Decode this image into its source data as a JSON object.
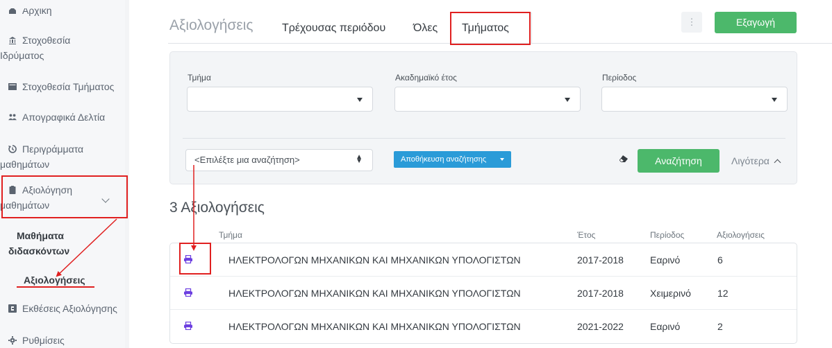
{
  "sidebar": {
    "items": [
      {
        "label": "Αρχική",
        "icon": "home-icon"
      },
      {
        "label": "Στοχοθεσία",
        "cont": "Ιδρύματος",
        "icon": "institution-icon"
      },
      {
        "label": "Στοχοθεσία Τμήματος",
        "icon": "department-icon"
      },
      {
        "label": "Απογραφικά Δελτία",
        "icon": "users-icon"
      },
      {
        "label": "Περιγράμματα",
        "cont": "μαθημάτων",
        "icon": "history-icon"
      },
      {
        "label": "Αξιολόγηση",
        "cont": "μαθημάτων",
        "icon": "clipboard-icon"
      },
      {
        "label": "Εκθέσεις Αξιολόγησης",
        "icon": "report-icon"
      },
      {
        "label": "Ρυθμίσεις",
        "icon": "gear-icon"
      }
    ],
    "sub_items": [
      {
        "label": "Μαθήματα",
        "cont": "διδασκόντων"
      },
      {
        "label": "Αξιολογήσεις"
      }
    ]
  },
  "header": {
    "title": "Αξιολογήσεις",
    "tabs": [
      "Τρέχουσας περιόδου",
      "Όλες",
      "Τμήματος"
    ],
    "active_tab": "Τμήματος",
    "more_label": "⋮",
    "export_label": "Εξαγωγή"
  },
  "filters": {
    "department_label": "Τμήμα",
    "year_label": "Ακαδημαϊκό έτος",
    "period_label": "Περίοδος",
    "search_select_value": "<Επιλέξτε μια αναζήτηση>",
    "save_search_label": "Αποθήκευση αναζήτησης",
    "search_label": "Αναζήτηση",
    "less_label": "Λιγότερα"
  },
  "results": {
    "title": "3 Αξιολογήσεις",
    "columns": [
      "Τμήμα",
      "Έτος",
      "Περίοδος",
      "Αξιολογήσεις"
    ],
    "rows": [
      {
        "department": "ΗΛΕΚΤΡΟΛΟΓΩΝ ΜΗΧΑΝΙΚΩΝ ΚΑΙ ΜΗΧΑΝΙΚΩΝ ΥΠΟΛΟΓΙΣΤΩΝ",
        "year": "2017-2018",
        "period": "Εαρινό",
        "count": "6"
      },
      {
        "department": "ΗΛΕΚΤΡΟΛΟΓΩΝ ΜΗΧΑΝΙΚΩΝ ΚΑΙ ΜΗΧΑΝΙΚΩΝ ΥΠΟΛΟΓΙΣΤΩΝ",
        "year": "2017-2018",
        "period": "Χειμερινό",
        "count": "12"
      },
      {
        "department": "ΗΛΕΚΤΡΟΛΟΓΩΝ ΜΗΧΑΝΙΚΩΝ ΚΑΙ ΜΗΧΑΝΙΚΩΝ ΥΠΟΛΟΓΙΣΤΩΝ",
        "year": "2021-2022",
        "period": "Εαρινό",
        "count": "2"
      }
    ]
  },
  "colors": {
    "accent_green": "#4cb86b",
    "accent_blue": "#2a9bd8",
    "printer_icon": "#6c3fe0",
    "annotation_red": "#e02020"
  }
}
